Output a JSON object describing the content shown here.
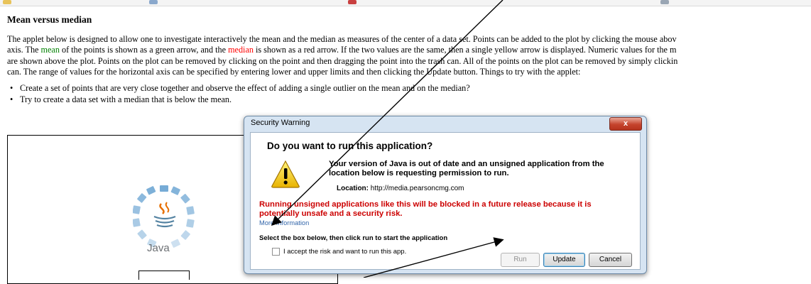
{
  "page": {
    "title": "Mean versus median",
    "intro_lines": [
      [
        "The applet below is designed to allow one to investigate interactively the mean and the median as measures of the center of a data set. Points can be added to the plot by clicking the mouse abov"
      ],
      [
        "axis. The ",
        "mean",
        " of the points is shown as a green arrow, and the ",
        "median",
        " is shown as a red arrow. If the two values are the same, then a single yellow arrow is displayed. Numeric values for the m"
      ],
      [
        "are shown above the plot. Points on the plot can be removed by clicking on the point and then dragging the point into the trash can. All of the points on the plot can be removed by simply clickin"
      ],
      [
        "can. The range of values for the horizontal axis can be specified by entering lower and upper limits and then clicking the Update button. Things to try with the applet:"
      ]
    ],
    "bullets": [
      "Create a set of points that are very close together and observe the effect of adding a single outlier on the mean and on the median?",
      "Try to create a data set with a median that is below the mean."
    ],
    "java_label": "Java"
  },
  "dialog": {
    "title": "Security Warning",
    "close_label": "x",
    "question": "Do you want to run this application?",
    "message": "Your version of Java is out of date and an unsigned application from the location below is requesting permission to run.",
    "location_label": "Location:",
    "location_value": "http://media.pearsoncmg.com",
    "risk": "Running unsigned applications like this will be blocked in a future release because it is potentially unsafe and a security risk.",
    "more_info": "More Information",
    "select_instruction": "Select the box below, then click run to start the application",
    "accept_label": "I accept the risk and want to run this app.",
    "buttons": {
      "run": "Run",
      "update": "Update",
      "cancel": "Cancel"
    }
  },
  "colors": {
    "mean": "#008000",
    "median": "#ff0000",
    "risk": "#cc0000",
    "link": "#3366aa"
  }
}
